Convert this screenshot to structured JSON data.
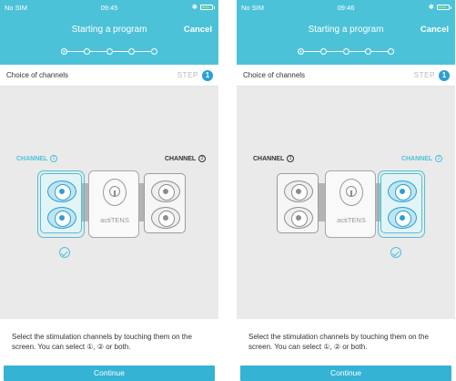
{
  "colors": {
    "accent": "#4cc2d8",
    "button": "#34b3d4",
    "step_badge": "#2a9fd6"
  },
  "screens": [
    {
      "status": {
        "carrier": "No SIM",
        "time": "09:45"
      },
      "header": {
        "title": "Starting a program",
        "cancel": "Cancel",
        "active_step": 1,
        "total_steps": 5
      },
      "section": {
        "label": "Choice of channels",
        "step_label": "STEP",
        "step_number": "1"
      },
      "channels": [
        {
          "name": "CHANNEL",
          "number": "1",
          "selected": true
        },
        {
          "name": "CHANNEL",
          "number": "2",
          "selected": false
        }
      ],
      "device_logo": "actiTENS",
      "instructions": "Select the stimulation channels by touching them on the screen. You can select ①, ② or both.",
      "continue": "Continue"
    },
    {
      "status": {
        "carrier": "No SIM",
        "time": "09:46"
      },
      "header": {
        "title": "Starting a program",
        "cancel": "Cancel",
        "active_step": 1,
        "total_steps": 5
      },
      "section": {
        "label": "Choice of channels",
        "step_label": "STEP",
        "step_number": "1"
      },
      "channels": [
        {
          "name": "CHANNEL",
          "number": "1",
          "selected": false
        },
        {
          "name": "CHANNEL",
          "number": "2",
          "selected": true
        }
      ],
      "device_logo": "actiTENS",
      "instructions": "Select the stimulation channels by touching them on the screen. You can select ①, ② or both.",
      "continue": "Continue"
    }
  ]
}
